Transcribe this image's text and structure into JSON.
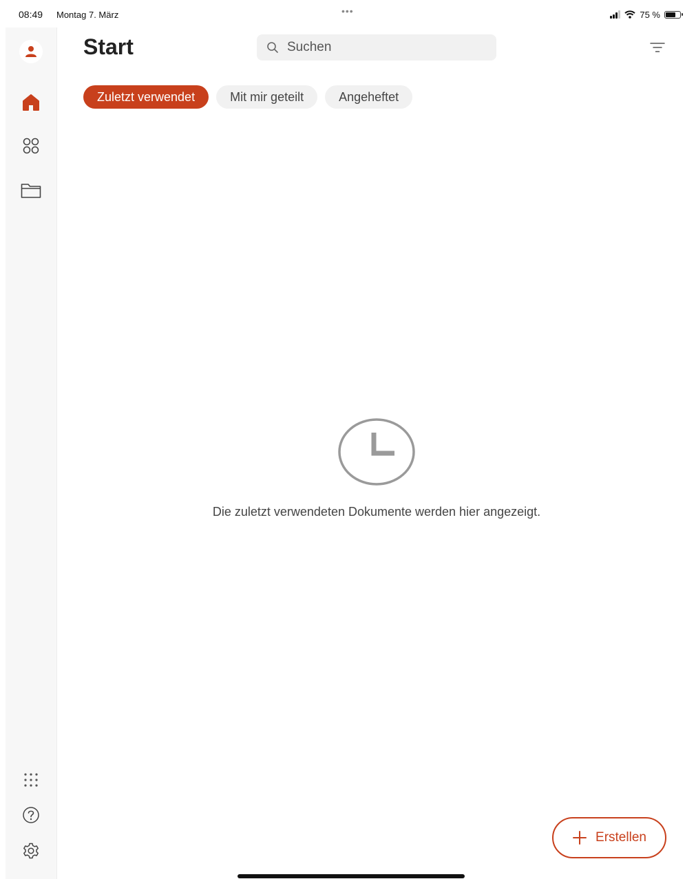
{
  "status_bar": {
    "time": "08:49",
    "date": "Montag 7. März",
    "dots": "•••",
    "battery_percent": "75 %"
  },
  "sidebar": {
    "items": [
      {
        "name": "profile",
        "icon": "person-icon"
      },
      {
        "name": "home",
        "icon": "home-icon",
        "active": true
      },
      {
        "name": "apps",
        "icon": "apps-grid-icon"
      },
      {
        "name": "files",
        "icon": "folder-icon"
      }
    ],
    "bottom_items": [
      {
        "name": "more-apps",
        "icon": "dots-grid-icon"
      },
      {
        "name": "help",
        "icon": "help-icon"
      },
      {
        "name": "settings",
        "icon": "gear-icon"
      }
    ]
  },
  "header": {
    "title": "Start",
    "search_placeholder": "Suchen"
  },
  "tabs": [
    {
      "label": "Zuletzt verwendet",
      "active": true
    },
    {
      "label": "Mit mir geteilt",
      "active": false
    },
    {
      "label": "Angeheftet",
      "active": false
    }
  ],
  "empty_state": {
    "icon": "clock-icon",
    "message": "Die zuletzt verwendeten Dokumente werden hier angezeigt."
  },
  "create_button": {
    "label": "Erstellen",
    "icon": "plus-icon"
  },
  "colors": {
    "accent": "#c8401c",
    "sidebar_bg": "#f7f7f7",
    "chip_bg": "#f1f1f1"
  }
}
